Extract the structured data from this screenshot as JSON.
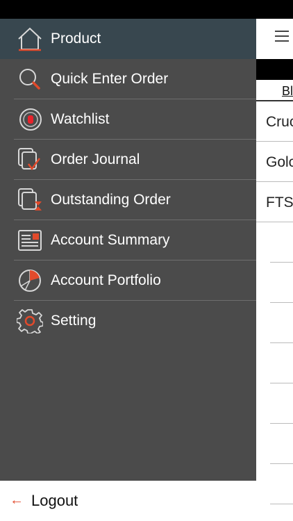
{
  "background": {
    "tab_label": "Bl",
    "rows": [
      "Cruc",
      "Golc",
      "FTS",
      "",
      "",
      "",
      "",
      "",
      "",
      ""
    ]
  },
  "drawer": {
    "items": [
      {
        "label": "Product",
        "icon": "house-icon",
        "active": true
      },
      {
        "label": "Quick Enter Order",
        "icon": "magnifier-icon"
      },
      {
        "label": "Watchlist",
        "icon": "watchlist-icon"
      },
      {
        "label": "Order Journal",
        "icon": "journal-check-icon"
      },
      {
        "label": "Outstanding Order",
        "icon": "hourglass-docs-icon"
      },
      {
        "label": "Account Summary",
        "icon": "newspaper-icon"
      },
      {
        "label": "Account Portfolio",
        "icon": "pie-chart-icon"
      },
      {
        "label": "Setting",
        "icon": "gear-icon"
      }
    ],
    "logout_label": "Logout"
  },
  "colors": {
    "drawer_bg": "#4b4b4b",
    "active_bg": "#38474f",
    "accent": "#e24a2b"
  }
}
